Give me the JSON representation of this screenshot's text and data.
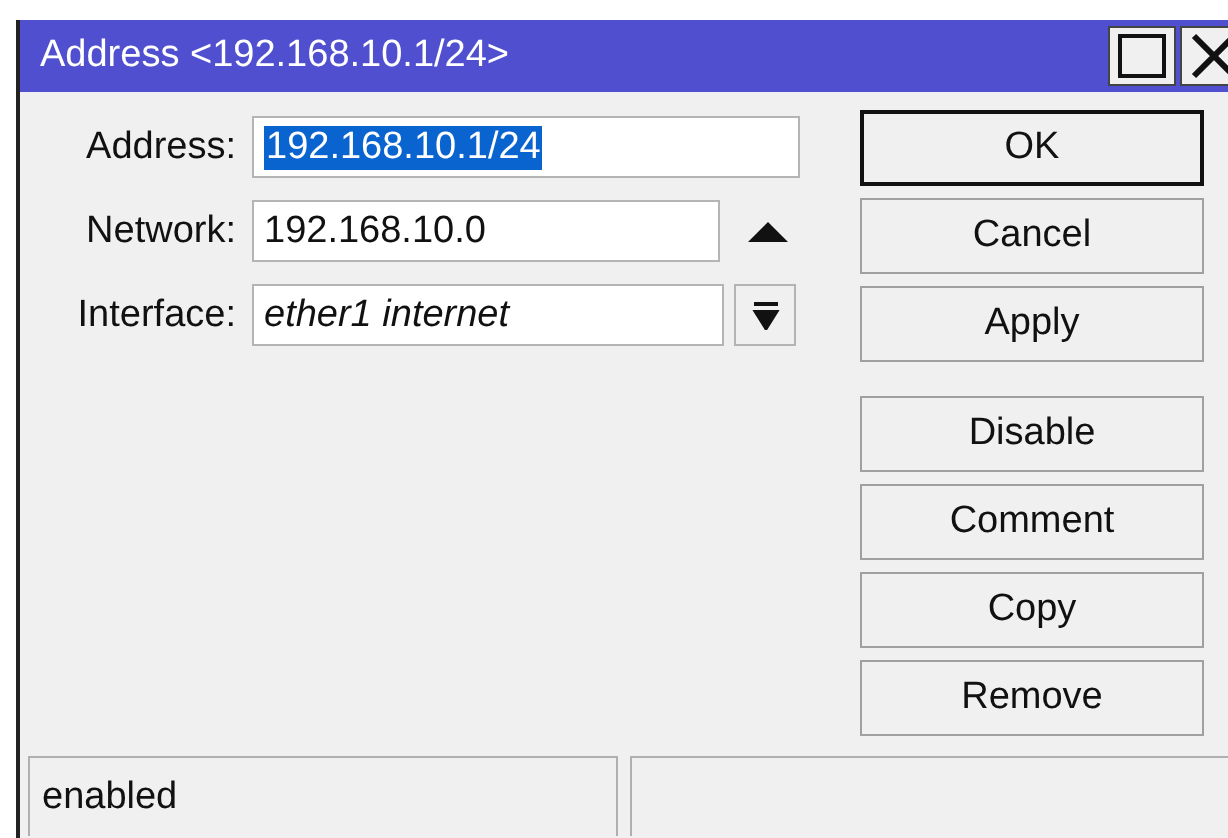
{
  "window": {
    "title": "Address <192.168.10.1/24>"
  },
  "fields": [
    {
      "label": "Address:",
      "value": "192.168.10.1/24",
      "selected": true,
      "italic": false,
      "kind": "plain"
    },
    {
      "label": "Network:",
      "value": "192.168.10.0",
      "selected": false,
      "italic": false,
      "kind": "toggle"
    },
    {
      "label": "Interface:",
      "value": "ether1 internet",
      "selected": false,
      "italic": true,
      "kind": "dropdown"
    }
  ],
  "button_groups": [
    [
      {
        "label": "OK",
        "default": true
      },
      {
        "label": "Cancel",
        "default": false
      },
      {
        "label": "Apply",
        "default": false
      }
    ],
    [
      {
        "label": "Disable",
        "default": false
      },
      {
        "label": "Comment",
        "default": false
      },
      {
        "label": "Copy",
        "default": false
      },
      {
        "label": "Remove",
        "default": false
      }
    ]
  ],
  "status_bar": [
    "enabled"
  ]
}
